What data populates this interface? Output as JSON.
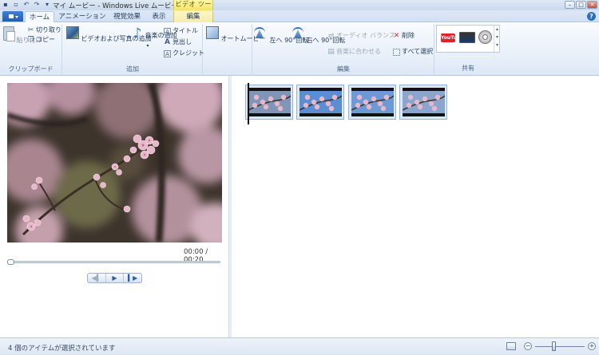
{
  "window": {
    "title": "マイ ムービー - Windows Live ムービー ...",
    "context_tab_group": "ビデオ ツール"
  },
  "tabs": [
    {
      "label": "ホーム",
      "active": true
    },
    {
      "label": "アニメーション",
      "active": false
    },
    {
      "label": "視覚効果",
      "active": false
    },
    {
      "label": "表示",
      "active": false
    },
    {
      "label": "編集",
      "active": false,
      "contextual": true
    }
  ],
  "ribbon": {
    "clipboard": {
      "label": "クリップボード",
      "paste": "貼り付け",
      "cut": "切り取り",
      "copy": "コピー"
    },
    "add": {
      "label": "追加",
      "add_video_photo": "ビデオおよび写真の追加",
      "add_music": "音楽の追加",
      "title": "タイトル",
      "caption": "見出し",
      "credits": "クレジット"
    },
    "automovie": "オートムービー",
    "editing": {
      "label": "編集",
      "rotate_left": "左へ 90°回転",
      "rotate_right": "右へ 90°回転",
      "audio_balance": "オーディオ バランス",
      "fit_to_music": "音楽に合わせる",
      "delete": "削除",
      "select_all": "すべて選択"
    },
    "share": {
      "label": "共有",
      "youtube_icon_text": "YouTube"
    }
  },
  "preview": {
    "time": "00:00 / 00:20",
    "playback_progress": 0
  },
  "storyboard": {
    "clips": [
      {
        "name": "clip-1",
        "sky": "#7f96b8"
      },
      {
        "name": "clip-2",
        "sky": "#5a8ed2"
      },
      {
        "name": "clip-3",
        "sky": "#6d9ad4"
      },
      {
        "name": "clip-4",
        "sky": "#8aa6cf"
      }
    ]
  },
  "status": {
    "text": "4 個のアイテムが選択されています",
    "zoom_level": 0.35
  },
  "colors": {
    "ribbon_accent": "#2d6cc4",
    "context_tab": "#f3e36a",
    "blossom_pink": "#e7b8cb"
  }
}
